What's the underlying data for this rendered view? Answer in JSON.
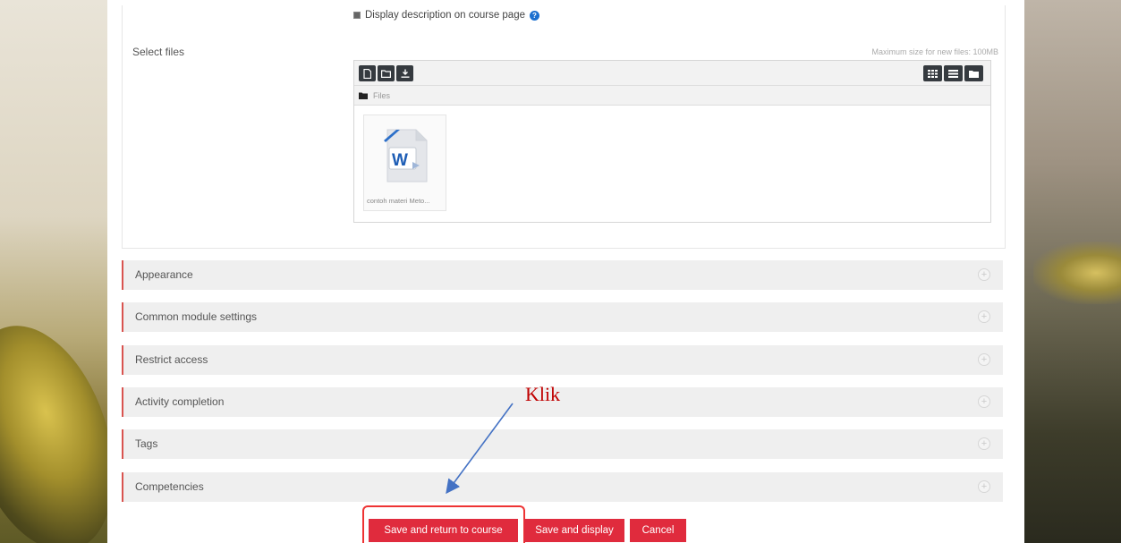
{
  "form": {
    "display_description_label": "Display description on course page",
    "select_files_label": "Select files",
    "max_size_text": "Maximum size for new files: 100MB"
  },
  "file_manager": {
    "path_label": "Files",
    "files": [
      {
        "name": "contoh materi Meto...",
        "icon": "word-document-icon"
      }
    ]
  },
  "sections": [
    {
      "title": "Appearance"
    },
    {
      "title": "Common module settings"
    },
    {
      "title": "Restrict access"
    },
    {
      "title": "Activity completion"
    },
    {
      "title": "Tags"
    },
    {
      "title": "Competencies"
    }
  ],
  "buttons": {
    "save_return": "Save and return to course",
    "save_display": "Save and display",
    "cancel": "Cancel"
  },
  "annotation": {
    "text": "Klik"
  },
  "colors": {
    "accent": "#e02b3d",
    "section_border": "#d9534f",
    "annotation": "#c00000",
    "arrow": "#4472c4"
  }
}
